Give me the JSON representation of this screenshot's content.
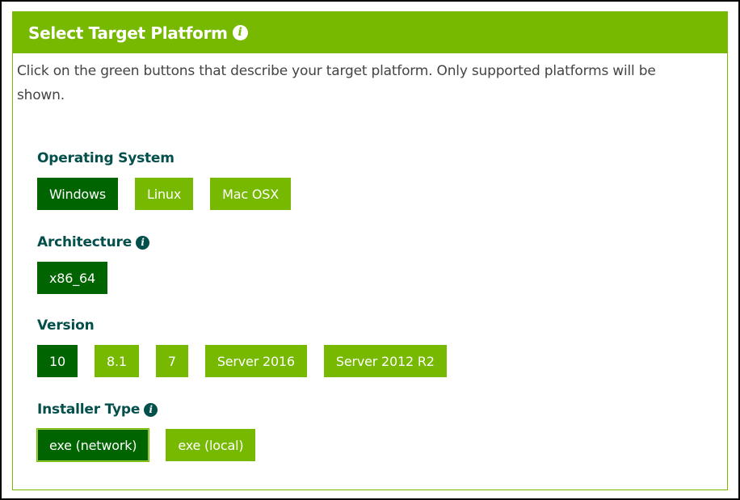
{
  "panel": {
    "title": "Select Target Platform",
    "info_icon": "info-circle-icon",
    "intro": "Click on the green buttons that describe your target platform. Only supported platforms will be shown."
  },
  "sections": {
    "os": {
      "label": "Operating System",
      "options": [
        "Windows",
        "Linux",
        "Mac OSX"
      ],
      "selected": "Windows"
    },
    "arch": {
      "label": "Architecture",
      "options": [
        "x86_64"
      ],
      "selected": "x86_64"
    },
    "version": {
      "label": "Version",
      "options": [
        "10",
        "8.1",
        "7",
        "Server 2016",
        "Server 2012 R2"
      ],
      "selected": "10"
    },
    "installer": {
      "label": "Installer Type",
      "options": [
        "exe (network)",
        "exe (local)"
      ],
      "selected": "exe (network)"
    }
  },
  "colors": {
    "accent_green": "#76b900",
    "selected_green": "#006400",
    "label_teal": "#034f4c",
    "text_gray": "#444444"
  }
}
